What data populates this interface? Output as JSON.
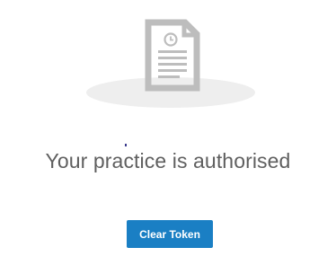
{
  "status": {
    "message": "Your practice is authorised"
  },
  "actions": {
    "clear_token_label": "Clear Token"
  },
  "icons": {
    "document": "document-clock-icon",
    "shadow": "ellipse-shadow"
  },
  "colors": {
    "button_bg": "#1a7fc4",
    "button_text": "#ffffff",
    "message_text": "#5f5f5f",
    "icon_gray": "#bdbdbd",
    "shadow_gray": "#eeeeee"
  }
}
